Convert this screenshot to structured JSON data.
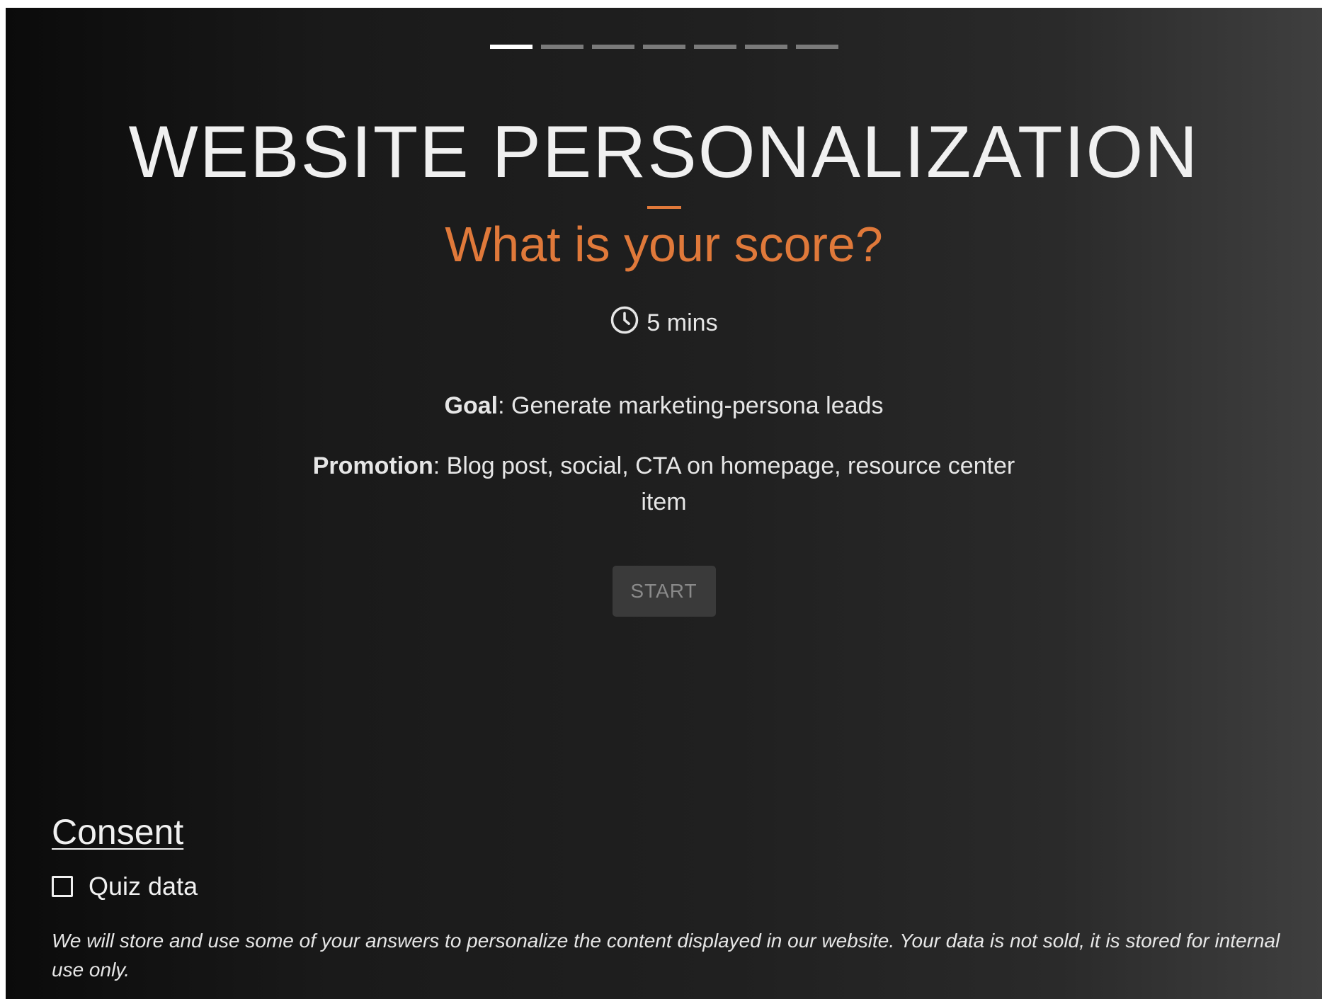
{
  "progress": {
    "total_steps": 7,
    "current_step": 1
  },
  "quiz": {
    "title": "WEBSITE PERSONALIZATION",
    "subtitle": "What is your score?",
    "duration": "5 mins",
    "goal_label": "Goal",
    "goal_value": "Generate marketing-persona leads",
    "promotion_label": "Promotion",
    "promotion_value": "Blog post, social, CTA on homepage, resource center item",
    "start_label": "START"
  },
  "consent": {
    "heading": "Consent",
    "checkbox_label": "Quiz data",
    "checkbox_checked": false,
    "disclaimer": "We will store and use some of your answers to personalize the content displayed in our website. Your data is not sold, it is stored for internal use only."
  },
  "colors": {
    "accent": "#e0793a",
    "text": "#e6e6e6",
    "button_bg": "#3a3a3a"
  },
  "icons": {
    "duration": "clock-icon"
  }
}
